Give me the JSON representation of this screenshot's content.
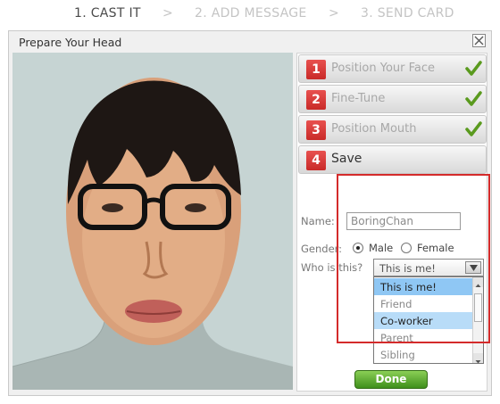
{
  "steps": [
    {
      "label": "1. CAST IT",
      "active": true
    },
    {
      "label": "2. ADD MESSAGE",
      "active": false
    },
    {
      "label": "3. SEND CARD",
      "active": false
    }
  ],
  "step_separator": ">",
  "dialog": {
    "title": "Prepare Your Head",
    "close_icon": "close-icon"
  },
  "accordion": [
    {
      "number": "1",
      "label": "Position Your Face",
      "completed": true
    },
    {
      "number": "2",
      "label": "Fine-Tune",
      "completed": true
    },
    {
      "number": "3",
      "label": "Position Mouth",
      "completed": true
    },
    {
      "number": "4",
      "label": "Save",
      "completed": false,
      "active": true
    }
  ],
  "form": {
    "name_label": "Name:",
    "name_value": "BoringChan",
    "gender_label": "Gender:",
    "gender_options": [
      {
        "label": "Male",
        "selected": true
      },
      {
        "label": "Female",
        "selected": false
      }
    ],
    "who_label": "Who is this?",
    "who_selected": "This is me!",
    "who_options": [
      {
        "label": "This is me!",
        "state": "selected"
      },
      {
        "label": "Friend",
        "state": "normal"
      },
      {
        "label": "Co-worker",
        "state": "hover"
      },
      {
        "label": "Parent",
        "state": "normal"
      },
      {
        "label": "Sibling",
        "state": "normal"
      }
    ],
    "done_label": "Done"
  },
  "colors": {
    "step_badge": "#d9403e",
    "check": "#5a9a1e",
    "done_button": "#4f9e28",
    "highlight_box": "#d42b2b",
    "photo_background": "#c6d4d3"
  }
}
